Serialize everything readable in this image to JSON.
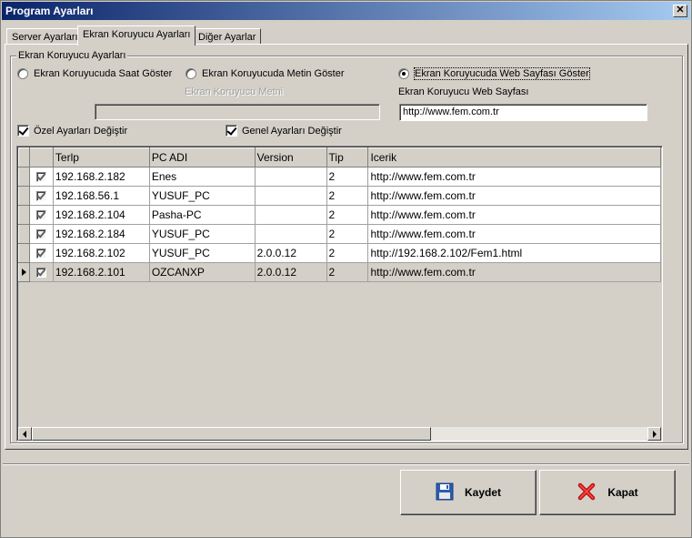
{
  "window": {
    "title": "Program Ayarları",
    "close_glyph": "✕"
  },
  "tabs": [
    {
      "label": "Server Ayarları",
      "active": false
    },
    {
      "label": "Ekran Koruyucu Ayarları",
      "active": true
    },
    {
      "label": "Diğer Ayarlar",
      "active": false
    }
  ],
  "group": {
    "legend": "Ekran Koruyucu Ayarları",
    "radio_clock": "Ekran Koruyucuda Saat Göster",
    "radio_text": "Ekran Koruyucuda Metin Göster",
    "radio_web": "Ekran Koruyucuda Web Sayfası Göster",
    "text_label": "Ekran Koruyucu Metni",
    "text_value": "",
    "web_label": "Ekran Koruyucu Web Sayfası",
    "web_value": "http://www.fem.com.tr",
    "check_custom": "Özel Ayarları Değiştir",
    "check_general": "Genel Ayarları Değiştir"
  },
  "grid": {
    "columns": [
      "Terlp",
      "PC ADI",
      "Version",
      "Tip",
      "Icerik"
    ],
    "rows": [
      {
        "ip": "192.168.2.182",
        "pc": "Enes",
        "version": "",
        "tip": "2",
        "icerik": "http://www.fem.com.tr"
      },
      {
        "ip": "192.168.56.1",
        "pc": "YUSUF_PC",
        "version": "",
        "tip": "2",
        "icerik": "http://www.fem.com.tr"
      },
      {
        "ip": "192.168.2.104",
        "pc": "Pasha-PC",
        "version": "",
        "tip": "2",
        "icerik": "http://www.fem.com.tr"
      },
      {
        "ip": "192.168.2.184",
        "pc": "YUSUF_PC",
        "version": "",
        "tip": "2",
        "icerik": "http://www.fem.com.tr"
      },
      {
        "ip": "192.168.2.102",
        "pc": "YUSUF_PC",
        "version": "2.0.0.12",
        "tip": "2",
        "icerik": "http://192.168.2.102/Fem1.html"
      },
      {
        "ip": "192.168.2.101",
        "pc": "OZCANXP",
        "version": "2.0.0.12",
        "tip": "2",
        "icerik": "http://www.fem.com.tr"
      }
    ]
  },
  "buttons": {
    "save": "Kaydet",
    "close": "Kapat"
  },
  "icons": {
    "save": "floppy-disk-icon",
    "close": "red-x-icon"
  }
}
